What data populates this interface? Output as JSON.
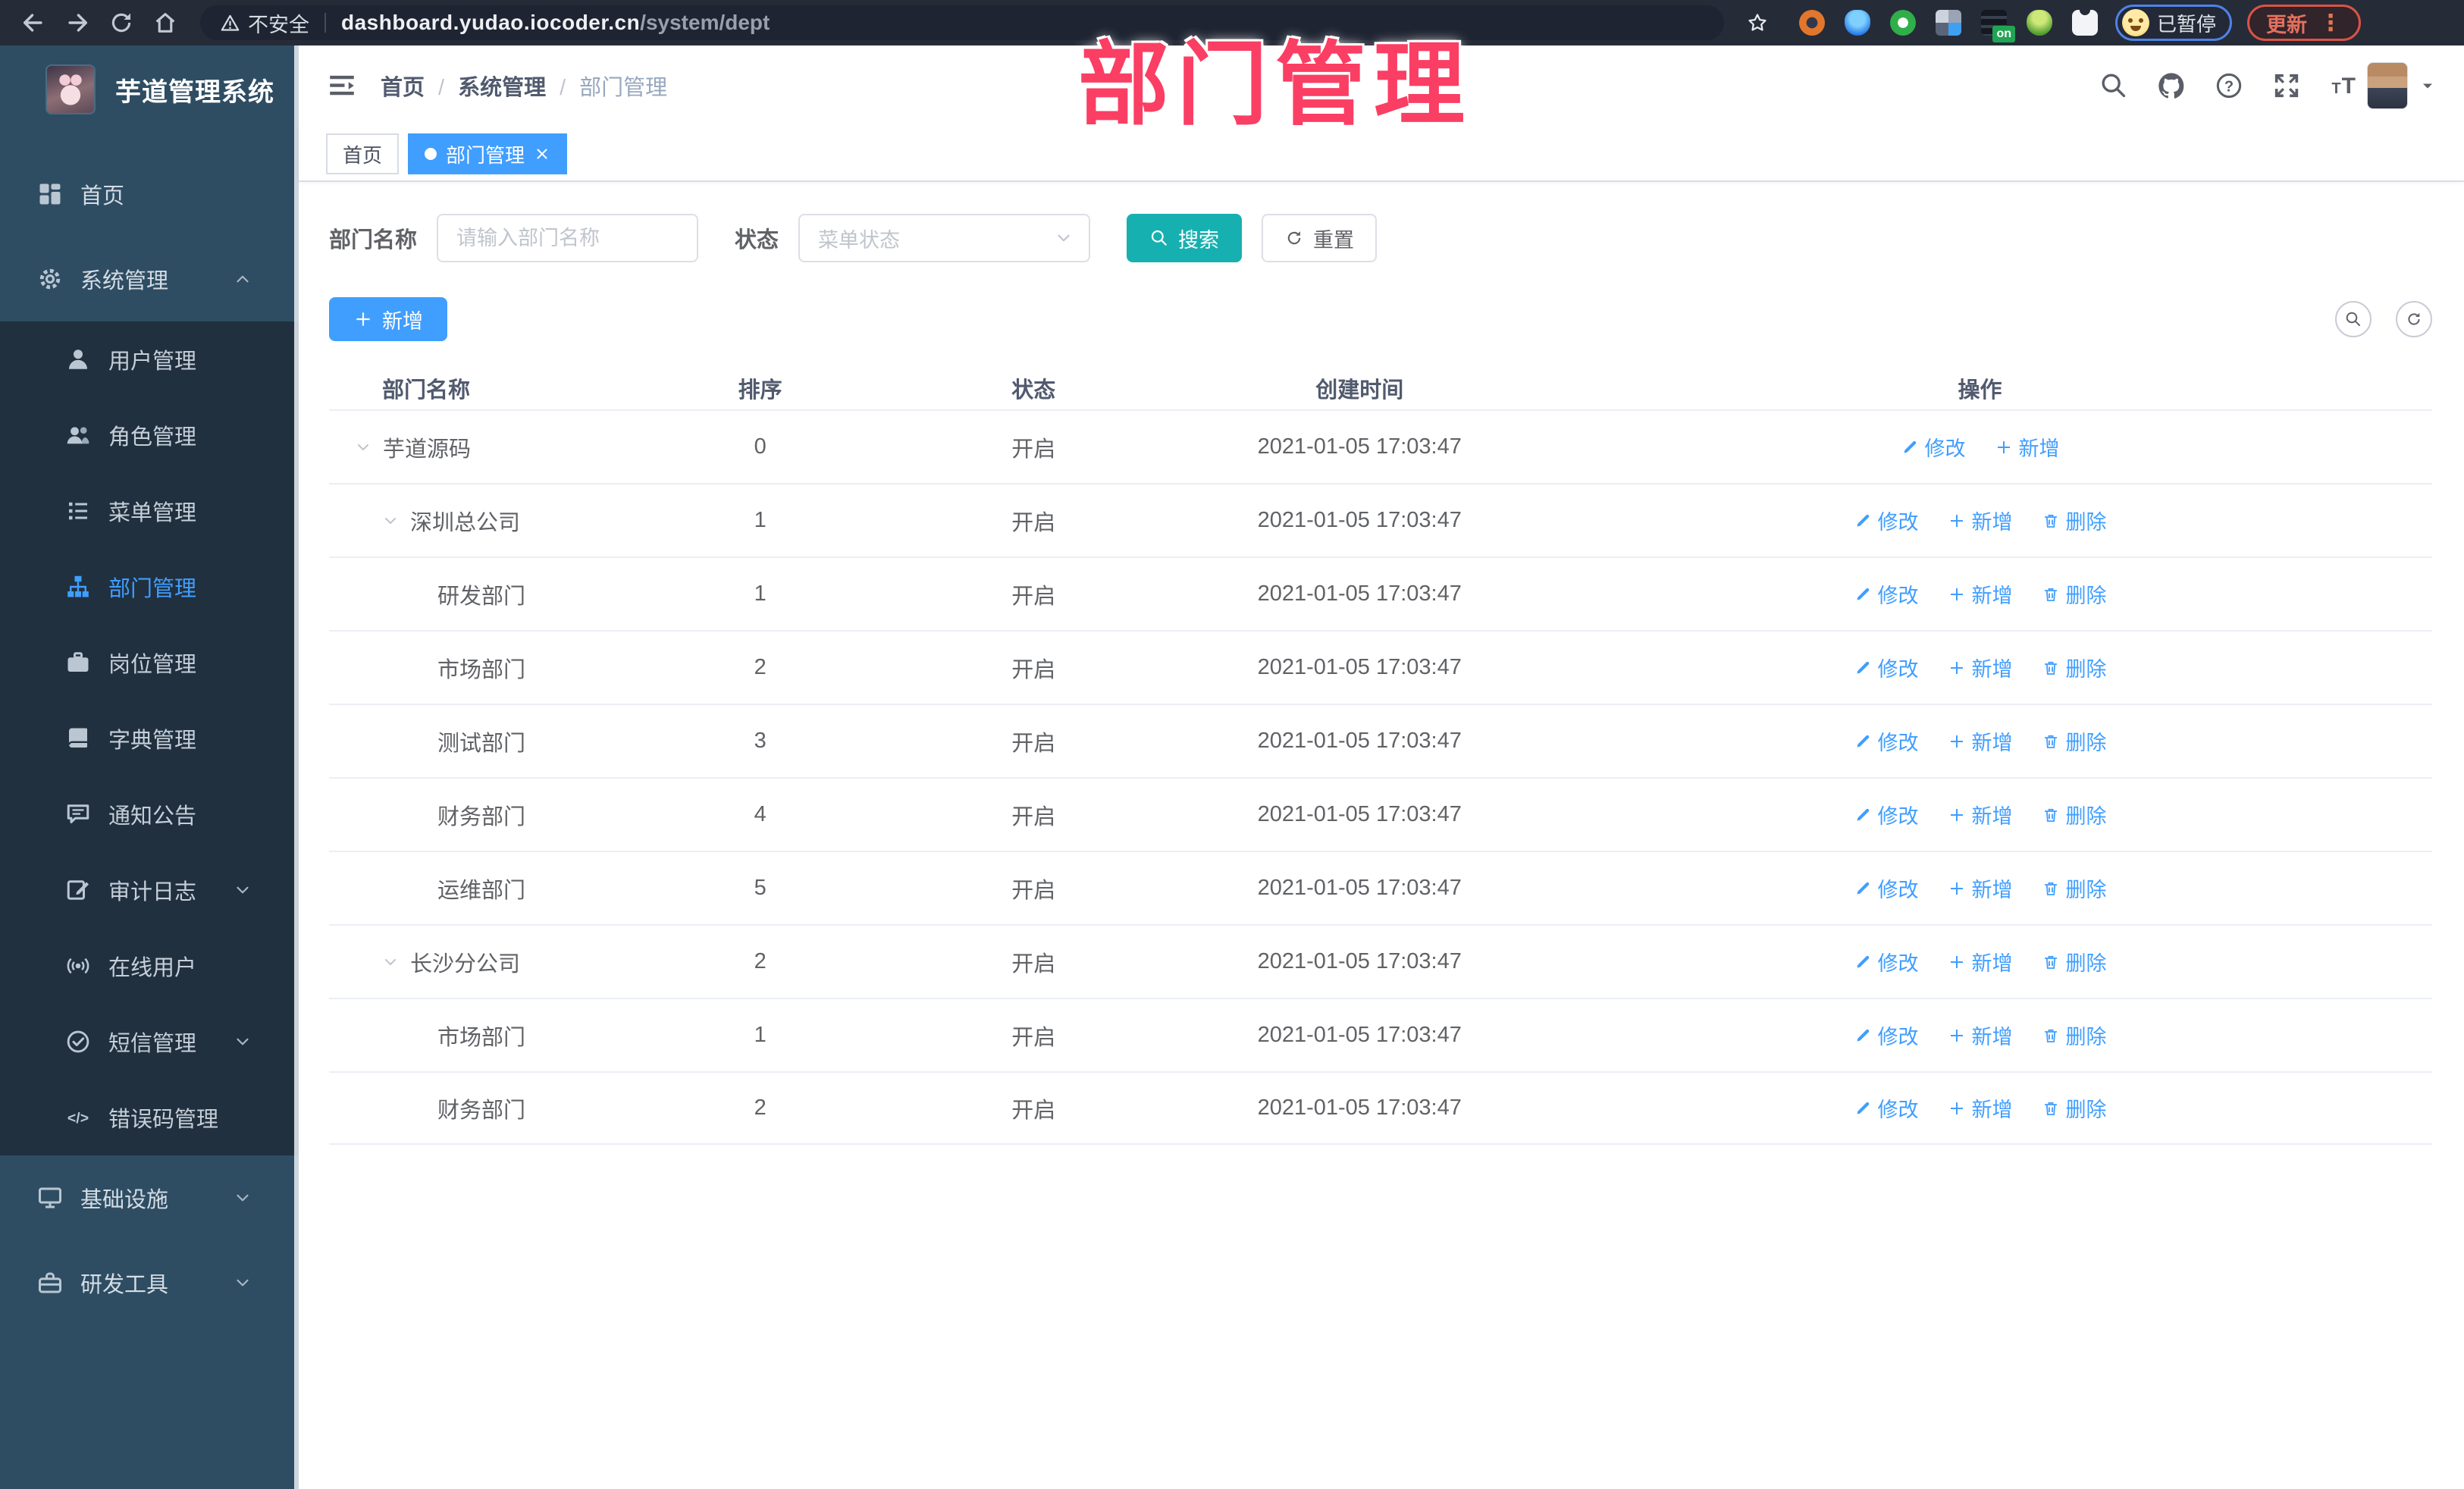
{
  "browser": {
    "security_label": "不安全",
    "url_host": "dashboard.yudao.iocoder.cn",
    "url_path": "/system/dept",
    "extension_on_badge": "on",
    "paused_label": "已暂停",
    "update_label": "更新",
    "update_menu_glyph": "⋮"
  },
  "watermark_text": "部门管理",
  "sidebar": {
    "title": "芋道管理系统",
    "items": [
      {
        "label": "首页",
        "icon": "dashboard",
        "level": 0
      },
      {
        "label": "系统管理",
        "icon": "system",
        "level": 0,
        "chevron": "up"
      },
      {
        "label": "用户管理",
        "icon": "user",
        "level": 1
      },
      {
        "label": "角色管理",
        "icon": "role",
        "level": 1
      },
      {
        "label": "菜单管理",
        "icon": "menu",
        "level": 1
      },
      {
        "label": "部门管理",
        "icon": "dept",
        "level": 1,
        "active": true
      },
      {
        "label": "岗位管理",
        "icon": "post",
        "level": 1
      },
      {
        "label": "字典管理",
        "icon": "dict",
        "level": 1
      },
      {
        "label": "通知公告",
        "icon": "notice",
        "level": 1
      },
      {
        "label": "审计日志",
        "icon": "audit",
        "level": 1,
        "chevron": "down"
      },
      {
        "label": "在线用户",
        "icon": "online",
        "level": 1
      },
      {
        "label": "短信管理",
        "icon": "sms",
        "level": 1,
        "chevron": "down"
      },
      {
        "label": "错误码管理",
        "icon": "errcode",
        "level": 1
      },
      {
        "label": "基础设施",
        "icon": "infra",
        "level": 0,
        "chevron": "down"
      },
      {
        "label": "研发工具",
        "icon": "devtool",
        "level": 0,
        "chevron": "down"
      }
    ]
  },
  "header": {
    "breadcrumb": [
      "首页",
      "系统管理",
      "部门管理"
    ],
    "icons": [
      "search",
      "github",
      "help",
      "fullscreen",
      "fontsize"
    ]
  },
  "tabs": [
    {
      "label": "首页",
      "active": false
    },
    {
      "label": "部门管理",
      "active": true,
      "closable": true
    }
  ],
  "filters": {
    "name_label": "部门名称",
    "name_placeholder": "请输入部门名称",
    "name_value": "",
    "status_label": "状态",
    "status_placeholder": "菜单状态",
    "search_label": "搜索",
    "reset_label": "重置"
  },
  "toolbar": {
    "add_label": "新增"
  },
  "table": {
    "columns": [
      "部门名称",
      "排序",
      "状态",
      "创建时间",
      "操作"
    ],
    "action_labels": {
      "edit": "修改",
      "add": "新增",
      "del": "删除"
    },
    "rows": [
      {
        "name": "芋道源码",
        "level": 0,
        "expandable": true,
        "sort": "0",
        "status": "开启",
        "time": "2021-01-05 17:03:47",
        "actions": [
          "edit",
          "add"
        ]
      },
      {
        "name": "深圳总公司",
        "level": 1,
        "expandable": true,
        "sort": "1",
        "status": "开启",
        "time": "2021-01-05 17:03:47",
        "actions": [
          "edit",
          "add",
          "del"
        ]
      },
      {
        "name": "研发部门",
        "level": 2,
        "expandable": false,
        "sort": "1",
        "status": "开启",
        "time": "2021-01-05 17:03:47",
        "actions": [
          "edit",
          "add",
          "del"
        ]
      },
      {
        "name": "市场部门",
        "level": 2,
        "expandable": false,
        "sort": "2",
        "status": "开启",
        "time": "2021-01-05 17:03:47",
        "actions": [
          "edit",
          "add",
          "del"
        ]
      },
      {
        "name": "测试部门",
        "level": 2,
        "expandable": false,
        "sort": "3",
        "status": "开启",
        "time": "2021-01-05 17:03:47",
        "actions": [
          "edit",
          "add",
          "del"
        ]
      },
      {
        "name": "财务部门",
        "level": 2,
        "expandable": false,
        "sort": "4",
        "status": "开启",
        "time": "2021-01-05 17:03:47",
        "actions": [
          "edit",
          "add",
          "del"
        ]
      },
      {
        "name": "运维部门",
        "level": 2,
        "expandable": false,
        "sort": "5",
        "status": "开启",
        "time": "2021-01-05 17:03:47",
        "actions": [
          "edit",
          "add",
          "del"
        ]
      },
      {
        "name": "长沙分公司",
        "level": 1,
        "expandable": true,
        "sort": "2",
        "status": "开启",
        "time": "2021-01-05 17:03:47",
        "actions": [
          "edit",
          "add",
          "del"
        ]
      },
      {
        "name": "市场部门",
        "level": 2,
        "expandable": false,
        "sort": "1",
        "status": "开启",
        "time": "2021-01-05 17:03:47",
        "actions": [
          "edit",
          "add",
          "del"
        ]
      },
      {
        "name": "财务部门",
        "level": 2,
        "expandable": false,
        "sort": "2",
        "status": "开启",
        "time": "2021-01-05 17:03:47",
        "actions": [
          "edit",
          "add",
          "del"
        ]
      }
    ]
  },
  "colors": {
    "primary_blue": "#409eff",
    "search_teal": "#17b0b0",
    "sidebar_bg": "#2e4d63",
    "submenu_bg": "#20303f",
    "watermark_pink": "#fb3e63",
    "chrome_bg": "#262b38"
  }
}
